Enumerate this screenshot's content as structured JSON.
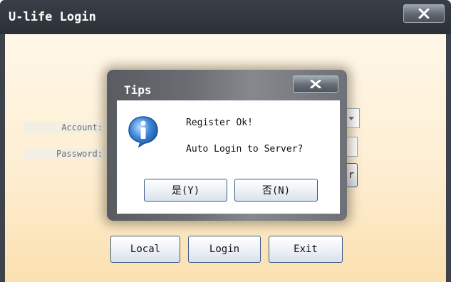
{
  "window": {
    "title": "U-life Login"
  },
  "form": {
    "account_label": "Account:",
    "password_label": "Password:"
  },
  "buttons": {
    "local": "Local",
    "login": "Login",
    "exit": "Exit",
    "partial_right": "r"
  },
  "dialog": {
    "title": "Tips",
    "line1": "Register Ok!",
    "line2": "Auto Login to Server?",
    "yes": "是(Y)",
    "no": "否(N)"
  },
  "icons": {
    "close": "close-icon",
    "info": "info-icon",
    "dropdown": "chevron-down-icon"
  },
  "colors": {
    "titlebar": "#2c3037",
    "client_bg": "#fdeed2",
    "button_border": "#3a5a88",
    "info_blue": "#1f5fb8"
  }
}
